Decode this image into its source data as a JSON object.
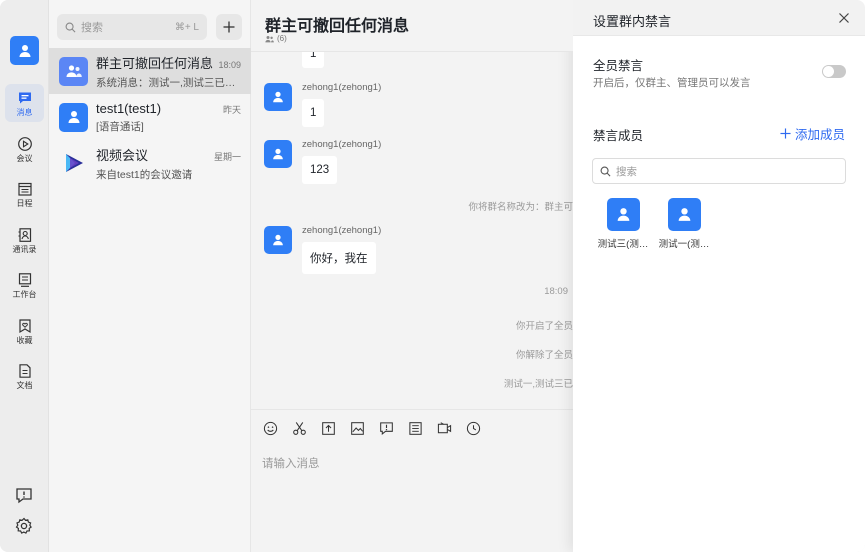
{
  "window": {
    "traffic_lights": [
      "close",
      "minimize",
      "maximize"
    ],
    "colors": {
      "accent": "#2f7ef6",
      "link": "#2f6af0"
    }
  },
  "rail": {
    "items": [
      {
        "label": "消息",
        "icon": "chat-icon",
        "active": true
      },
      {
        "label": "会议",
        "icon": "video-play-icon"
      },
      {
        "label": "日程",
        "icon": "calendar-icon"
      },
      {
        "label": "通讯录",
        "icon": "contacts-icon"
      },
      {
        "label": "工作台",
        "icon": "workbench-icon"
      },
      {
        "label": "收藏",
        "icon": "favorite-icon"
      },
      {
        "label": "文档",
        "icon": "document-icon"
      }
    ],
    "bottom": [
      "feedback-icon",
      "settings-icon"
    ]
  },
  "conversations": {
    "search": {
      "placeholder": "搜索",
      "shortcut": "⌘+ L"
    },
    "items": [
      {
        "name": "群主可撤回任何消息",
        "time": "18:09",
        "preview": "系统消息：测试一,测试三已被…",
        "avatar": "group-icon"
      },
      {
        "name": "test1(test1)",
        "time": "昨天",
        "preview": "[语音通话]",
        "avatar": "user-icon"
      },
      {
        "name": "视频会议",
        "time": "星期一",
        "preview": "来自test1的会议邀请",
        "avatar": "video-logo-icon"
      }
    ]
  },
  "chat": {
    "title": "群主可撤回任何消息",
    "member_count": "(6)",
    "messages": [
      {
        "sender": "",
        "text": "1"
      },
      {
        "sender": "zehong1(zehong1)",
        "text": "1"
      },
      {
        "sender": "zehong1(zehong1)",
        "text": "123"
      },
      {
        "system": "你将群名称改为：群主可"
      },
      {
        "sender": "zehong1(zehong1)",
        "text": "你好，我在"
      },
      {
        "system": "18:09"
      },
      {
        "system": "你开启了全员"
      },
      {
        "system": "你解除了全员"
      },
      {
        "system": "测试一,测试三已"
      }
    ],
    "composer_placeholder": "请输入消息",
    "toolbar": [
      "emoji-icon",
      "scissors-icon",
      "upload-file-icon",
      "image-icon",
      "feedback-icon",
      "schedule-icon",
      "video-call-icon",
      "clock-icon"
    ]
  },
  "panel": {
    "title": "设置群内禁言",
    "mute_all": {
      "title": "全员禁言",
      "desc": "开启后，仅群主、管理员可以发言",
      "enabled": false
    },
    "muted_members": {
      "title": "禁言成员",
      "add_label": "添加成员",
      "search_placeholder": "搜索",
      "members": [
        {
          "name": "测试三(测…"
        },
        {
          "name": "测试一(测…"
        }
      ]
    }
  }
}
